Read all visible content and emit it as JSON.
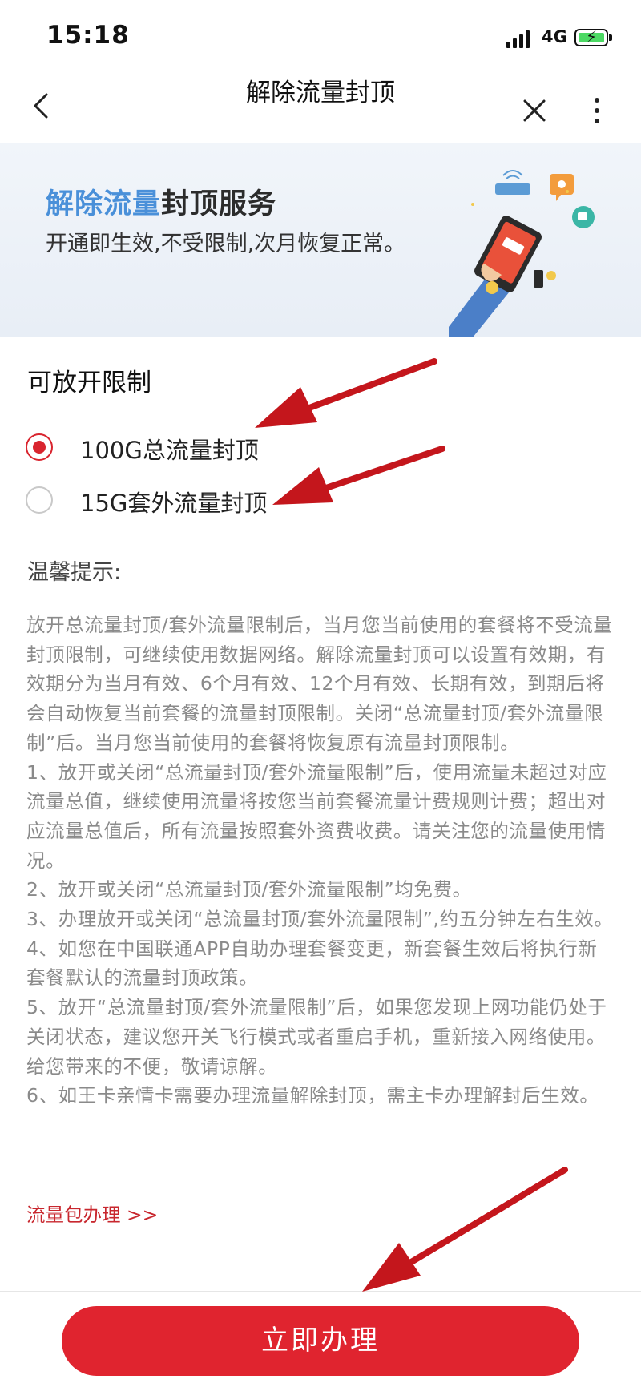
{
  "status_bar": {
    "time": "15:18",
    "network": "4G"
  },
  "nav": {
    "title": "解除流量封顶"
  },
  "banner": {
    "headline_highlight": "解除流量",
    "headline_rest": "封顶服务",
    "subtitle": "开通即生效,不受限制,次月恢复正常。"
  },
  "section": {
    "title": "可放开限制",
    "options": [
      {
        "label": "100G总流量封顶",
        "selected": true
      },
      {
        "label": "15G套外流量封顶",
        "selected": false
      }
    ]
  },
  "tips": {
    "heading": "温馨提示:",
    "paragraphs": [
      "放开总流量封顶/套外流量限制后，当月您当前使用的套餐将不受流量封顶限制，可继续使用数据网络。解除流量封顶可以设置有效期，有效期分为当月有效、6个月有效、12个月有效、长期有效，到期后将会自动恢复当前套餐的流量封顶限制。关闭“总流量封顶/套外流量限制”后。当月您当前使用的套餐将恢复原有流量封顶限制。",
      "1、放开或关闭“总流量封顶/套外流量限制”后，使用流量未超过对应流量总值，继续使用流量将按您当前套餐流量计费规则计费；超出对应流量总值后，所有流量按照套外资费收费。请关注您的流量使用情况。",
      "2、放开或关闭“总流量封顶/套外流量限制”均免费。",
      "3、办理放开或关闭“总流量封顶/套外流量限制”,约五分钟左右生效。",
      "4、如您在中国联通APP自助办理套餐变更，新套餐生效后将执行新套餐默认的流量封顶政策。",
      "5、放开“总流量封顶/套外流量限制”后，如果您发现上网功能仍处于关闭状态，建议您开关飞行模式或者重启手机，重新接入网络使用。给您带来的不便，敬请谅解。",
      "6、如王卡亲情卡需要办理流量解除封顶，需主卡办理解封后生效。"
    ],
    "link": "流量包办理 >>"
  },
  "cta": {
    "label": "立即办理"
  },
  "colors": {
    "accent": "#e0242f",
    "banner_highlight": "#4a90d9",
    "annotation_arrow": "#c4161c"
  }
}
